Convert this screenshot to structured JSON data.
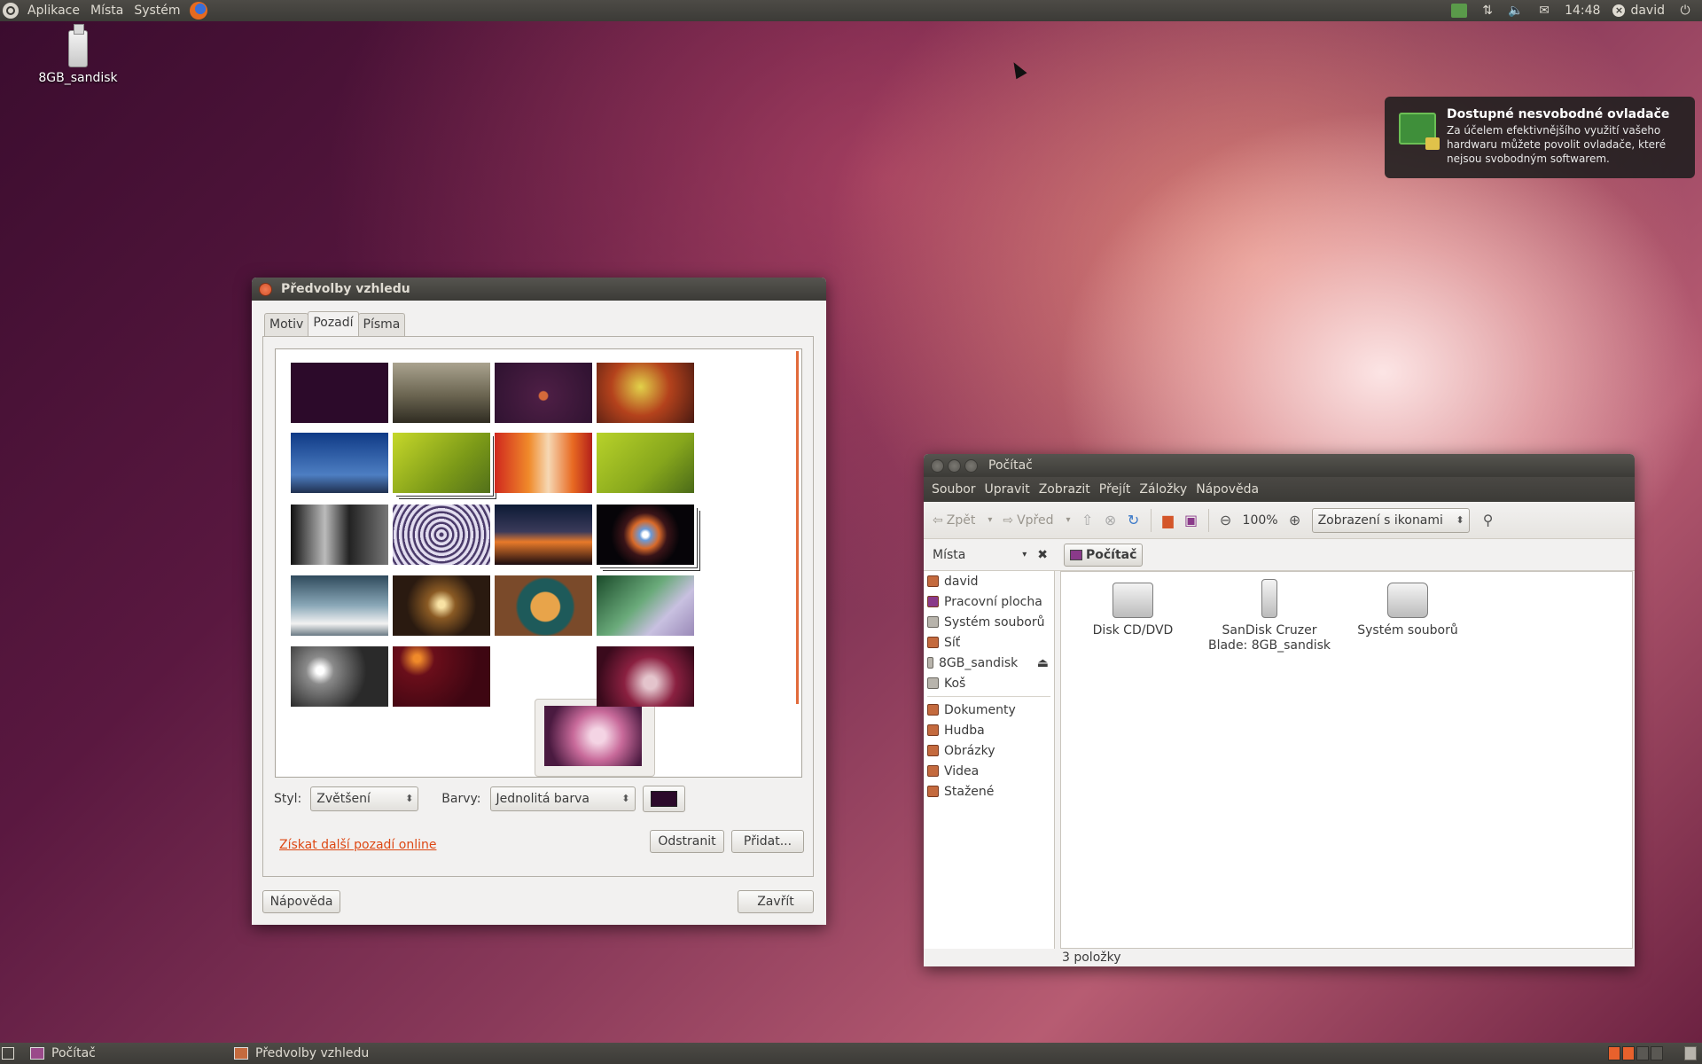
{
  "top_panel": {
    "menus": [
      "Aplikace",
      "Místa",
      "Systém"
    ],
    "clock": "14:48",
    "user": "david"
  },
  "desktop": {
    "icon_label": "8GB_sandisk"
  },
  "notification": {
    "title": "Dostupné nesvobodné ovladače",
    "body": "Za účelem efektivnějšího využití vašeho hardwaru můžete povolit ovladače, které nejsou svobodným softwarem."
  },
  "appearance": {
    "title": "Předvolby vzhledu",
    "tabs": [
      "Motiv",
      "Pozadí",
      "Písma"
    ],
    "active_tab": "Pozadí",
    "style_label": "Styl:",
    "style_value": "Zvětšení",
    "colors_label": "Barvy:",
    "colors_value": "Jednolitá barva",
    "selected_color": "#2c0a2a",
    "online_link": "Získat další pozadí online",
    "remove_button": "Odstranit",
    "add_button": "Přidat...",
    "help_button": "Nápověda",
    "close_button": "Zavřít"
  },
  "computer": {
    "title": "Počítač",
    "menus": [
      "Soubor",
      "Upravit",
      "Zobrazit",
      "Přejít",
      "Záložky",
      "Nápověda"
    ],
    "back": "Zpět",
    "forward": "Vpřed",
    "zoom": "100%",
    "view_mode": "Zobrazení s ikonami",
    "places_label": "Místa",
    "path_button": "Počítač",
    "sidebar": {
      "places": [
        "david",
        "Pracovní plocha",
        "Systém souborů",
        "Síť",
        "8GB_sandisk",
        "Koš"
      ],
      "bookmarks": [
        "Dokumenty",
        "Hudba",
        "Obrázky",
        "Videa",
        "Stažené"
      ]
    },
    "items": [
      {
        "label": "Disk CD/DVD"
      },
      {
        "label": "SanDisk Cruzer Blade: 8GB_sandisk"
      },
      {
        "label": "Systém souborů"
      }
    ],
    "status": "3 položky"
  },
  "taskbar": {
    "tasks": [
      "Počítač",
      "Předvolby vzhledu"
    ]
  }
}
